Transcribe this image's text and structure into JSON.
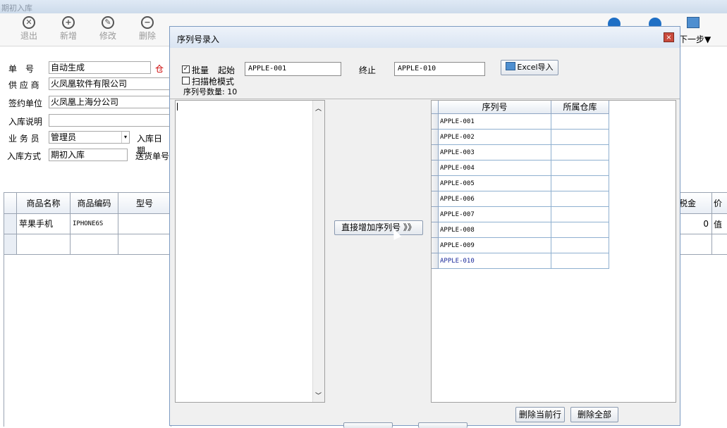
{
  "window": {
    "title": "期初入库"
  },
  "toolbar": {
    "exit": "退出",
    "add": "新增",
    "edit": "修改",
    "delete": "删除",
    "next": "下一步▼"
  },
  "form": {
    "bill_no_label": "单　号",
    "bill_no_value": "自动生成",
    "warehouse_label_partial": "仓",
    "supplier_label": "供 应 商",
    "supplier_value": "火凤凰软件有限公司",
    "sign_unit_label": "签约单位",
    "sign_unit_value": "火凤凰上海分公司",
    "note_label": "入库说明",
    "note_value": "",
    "salesman_label": "业 务 员",
    "salesman_value": "管理员",
    "in_date_label": "入库日期",
    "in_mode_label": "入库方式",
    "in_mode_value": "期初入库",
    "delivery_no_label": "送货单号"
  },
  "grid": {
    "columns": [
      "商品名称",
      "商品编码",
      "型号"
    ],
    "rows": [
      {
        "name": "苹果手机",
        "code": "IPHONE6S",
        "model": ""
      }
    ],
    "right_columns": [
      "税金",
      "价值"
    ],
    "right_value": "0"
  },
  "dialog": {
    "title": "序列号录入",
    "close": "×",
    "batch_label": "批量",
    "batch_checked": "✓",
    "start_label": "起始",
    "start_value": "APPLE-001",
    "end_label": "终止",
    "end_value": "APPLE-010",
    "excel_button": "Excel导入",
    "scan_label": "扫描枪模式",
    "count_label": "序列号数量: 10",
    "add_button": "直接增加序列号 》》",
    "delete_row_button": "删除当前行",
    "delete_all_button": "删除全部",
    "columns": [
      "序列号",
      "所属仓库"
    ],
    "serials": [
      "APPLE-001",
      "APPLE-002",
      "APPLE-003",
      "APPLE-004",
      "APPLE-005",
      "APPLE-006",
      "APPLE-007",
      "APPLE-008",
      "APPLE-009",
      "APPLE-010"
    ]
  }
}
